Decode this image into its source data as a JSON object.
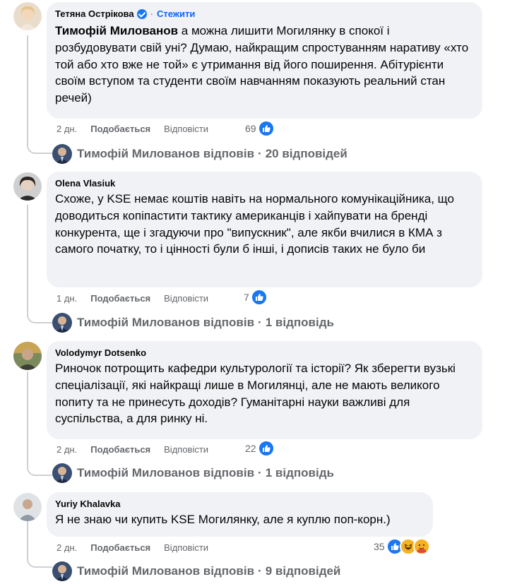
{
  "comments": [
    {
      "author": "Тетяна Острікова",
      "verified": true,
      "follow_label": "Стежити",
      "mention": "Тимофій Милованов",
      "text": " а можна лишити Могилянку в спокої і розбудовувати свій уні? Думаю, найкращим спростуванням наративу «хто той або хто вже не той» є утримання від його поширення. Абітурієнти своїм вступом та студенти своїм навчанням показують реальний стан речей)",
      "time": "2 дн.",
      "like_label": "Подобається",
      "reply_label": "Відповісти",
      "reaction_count": "69",
      "replies_author": "Тимофій Милованов",
      "replies_verb": "відповів",
      "replies_count": "20 відповідей"
    },
    {
      "author": "Olena Vlasiuk",
      "text": "Схоже, у KSE немає коштів навіть на нормального комунікаційника, що доводиться копіпастити тактику американців і хайпувати на бренді конкурента, ще і згадуючи про \"випускник\", але якби вчилися в КМА з самого початку, то і цінності були б інші, і дописів таких не було би",
      "time": "1 дн.",
      "like_label": "Подобається",
      "reply_label": "Відповісти",
      "reaction_count": "7",
      "replies_author": "Тимофій Милованов",
      "replies_verb": "відповів",
      "replies_count": "1 відповідь"
    },
    {
      "author": "Volodymyr Dotsenko",
      "text": "Риночок потрощить кафедри культурології та історії? Як зберегти вузькі спеціалізації, які найкращі лише в Могилянці, але не мають великого попиту та не принесуть доходів? Гуманітарні науки важливі для суспільства, а для ринку ні.",
      "time": "2 дн.",
      "like_label": "Подобається",
      "reply_label": "Відповісти",
      "reaction_count": "22",
      "replies_author": "Тимофій Милованов",
      "replies_verb": "відповів",
      "replies_count": "1 відповідь"
    },
    {
      "author": "Yuriy Khalavka",
      "text": "Я не знаю чи купить KSE Могилянку, але я куплю поп-корн.)",
      "time": "2 дн.",
      "like_label": "Подобається",
      "reply_label": "Відповісти",
      "reaction_count": "35",
      "replies_author": "Тимофій Милованов",
      "replies_verb": "відповів",
      "replies_count": "9 відповідей"
    }
  ],
  "separator": "·",
  "colors": {
    "accent": "#0866ff",
    "like": "#1877f2",
    "bubble": "#f0f2f5",
    "muted": "#65676b"
  },
  "icons": {
    "verified": "verified-badge-icon",
    "like": "like-reaction-icon",
    "haha": "haha-reaction-icon",
    "care": "care-reaction-icon"
  }
}
